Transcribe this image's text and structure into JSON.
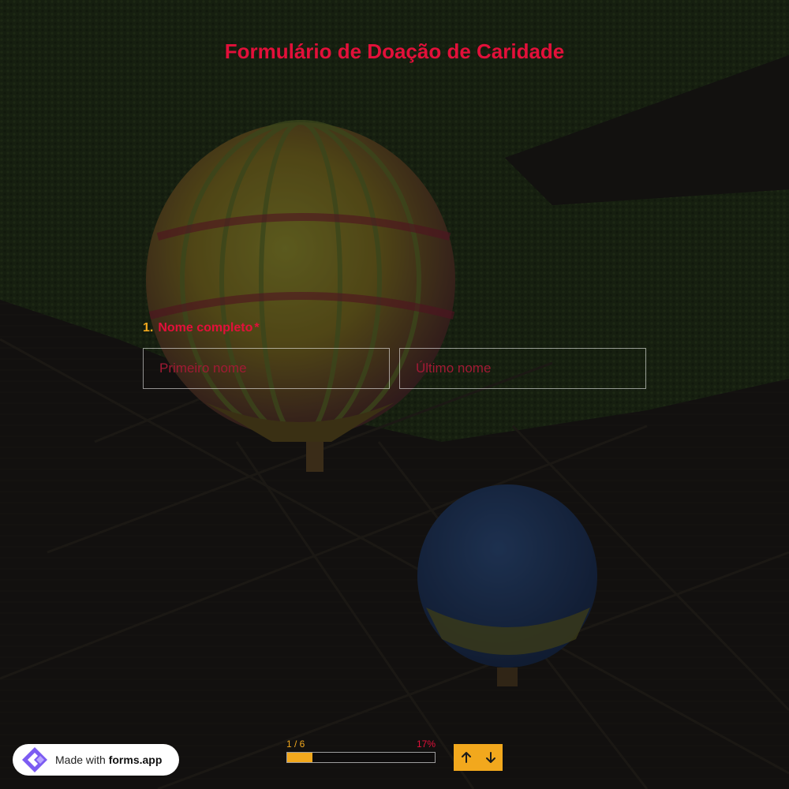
{
  "form": {
    "title": "Formulário de Doação de Caridade"
  },
  "question": {
    "number": "1.",
    "label": "Nome completo",
    "required_mark": "*",
    "first_name_placeholder": "Primeiro nome",
    "last_name_placeholder": "Último nome",
    "first_name_value": "",
    "last_name_value": ""
  },
  "progress": {
    "step_text": "1 / 6",
    "percent_text": "17%",
    "fraction": 0.17
  },
  "navigation": {
    "up_icon": "arrow-up-icon",
    "down_icon": "arrow-down-icon"
  },
  "badge": {
    "prefix": "Made with",
    "brand": "forms.app",
    "logo_icon": "forms-app-logo-icon"
  },
  "colors": {
    "title": "#e3103a",
    "accent": "#f2a81d",
    "input_border": "#ffffff"
  }
}
